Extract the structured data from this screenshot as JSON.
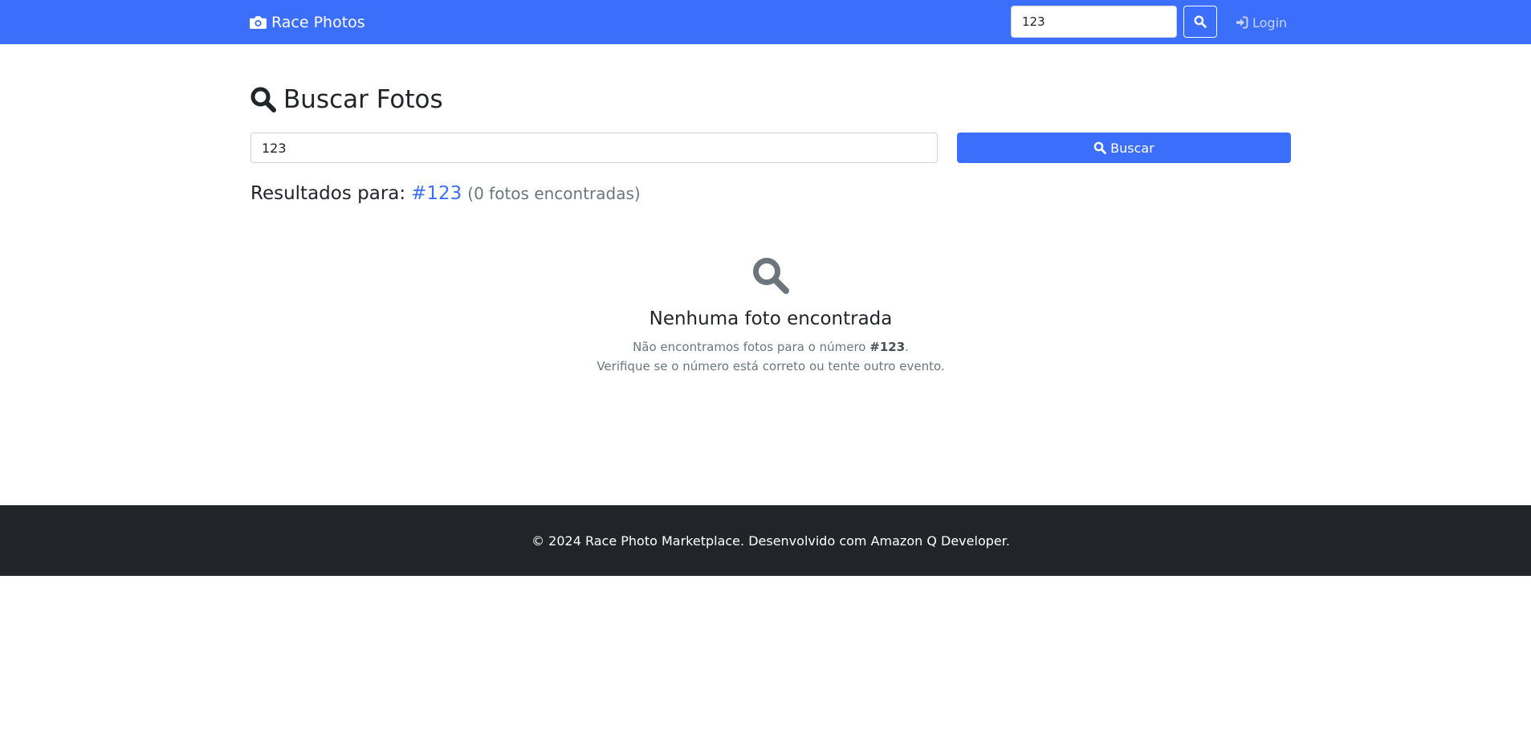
{
  "navbar": {
    "brand": "Race Photos",
    "search_value": "123",
    "login_label": "Login",
    "color": "#3b6ffb"
  },
  "page": {
    "title": "Buscar Fotos",
    "search_value": "123",
    "search_button": "Buscar"
  },
  "results": {
    "prefix": "Resultados para:",
    "number": "#123",
    "count_text": "(0 fotos encontradas)"
  },
  "empty_state": {
    "icon": "search-icon",
    "title": "Nenhuma foto encontrada",
    "line1_prefix": "Não encontramos fotos para o número ",
    "line1_number": "#123",
    "line1_suffix": ".",
    "line2": "Verifique se o número está correto ou tente outro evento."
  },
  "footer": {
    "text": "© 2024 Race Photo Marketplace. Desenvolvido com Amazon Q Developer.",
    "color": "#212529"
  }
}
